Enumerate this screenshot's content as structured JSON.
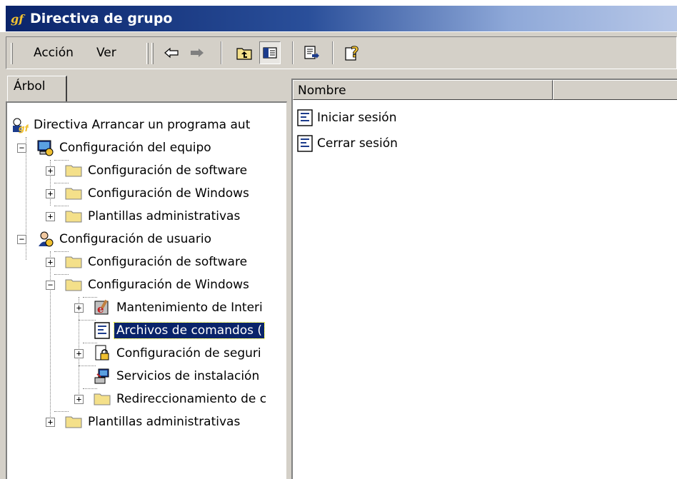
{
  "window": {
    "title": "Directiva de grupo"
  },
  "menu": {
    "action": "Acción",
    "view": "Ver"
  },
  "toolbar": {
    "icons": [
      "back-arrow-icon",
      "forward-arrow-icon",
      "up-one-level-icon",
      "show-hide-tree-icon",
      "export-list-icon",
      "help-icon"
    ]
  },
  "tree": {
    "tab_label": "Árbol",
    "root": "Directiva Arrancar un programa aut",
    "computer": "Configuración del equipo",
    "computer_software": "Configuración de software",
    "computer_windows": "Configuración de Windows",
    "computer_admin": "Plantillas administrativas",
    "user": "Configuración de usuario",
    "user_software": "Configuración de software",
    "user_windows": "Configuración de Windows",
    "ie_maintenance": "Mantenimiento de Interi",
    "scripts": "Archivos de comandos (",
    "security": "Configuración de seguri",
    "install_services": "Servicios de instalación",
    "redirection": "Redireccionamiento de c",
    "user_admin": "Plantillas administrativas"
  },
  "list": {
    "column_name": "Nombre",
    "rows": [
      "Iniciar sesión",
      "Cerrar sesión"
    ]
  },
  "colors": {
    "selection": "#0a246a",
    "folder": "#f4e08a",
    "face": "#d4d0c8"
  }
}
